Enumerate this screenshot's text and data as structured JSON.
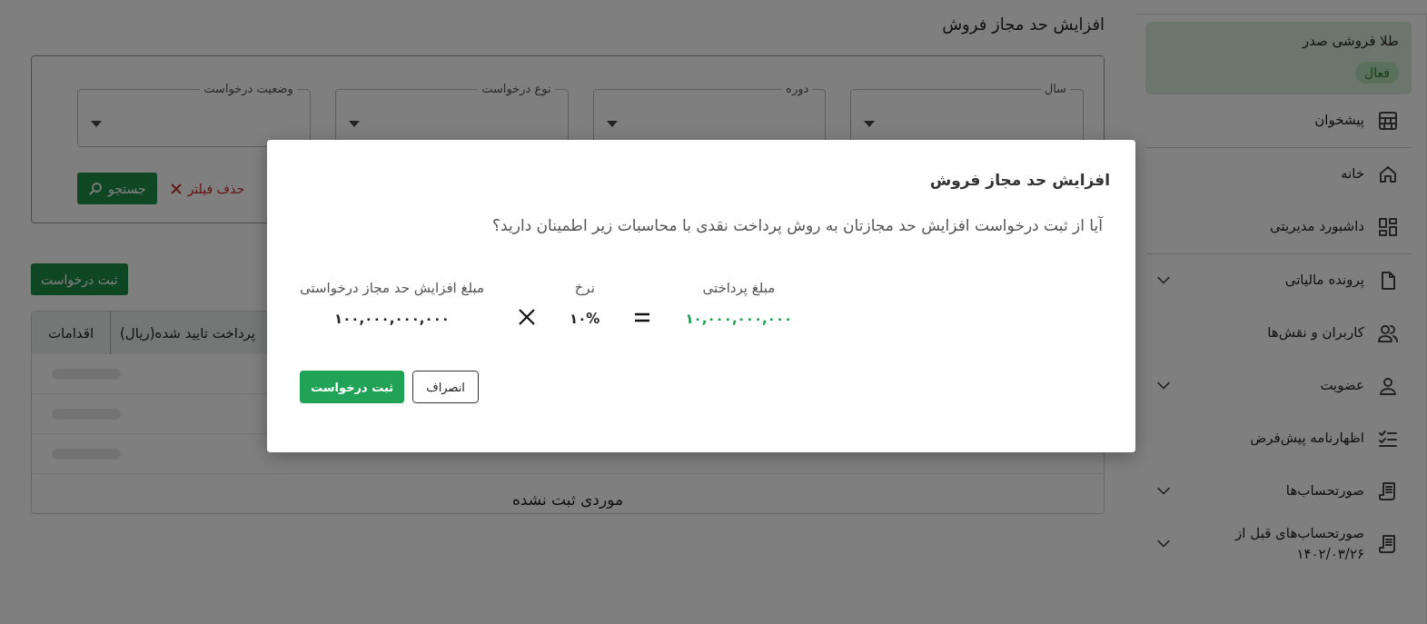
{
  "page": {
    "title": "افزایش حد مجاز فروش"
  },
  "filters": [
    {
      "label": "سال"
    },
    {
      "label": "دوره"
    },
    {
      "label": "نوع درخواست"
    },
    {
      "label": "وضعیت درخواست"
    }
  ],
  "filter_actions": {
    "clear": "حذف فیلتر",
    "search": "جستجو"
  },
  "register_button": "ثبت درخواست",
  "table": {
    "columns": [
      "پرداخت تایید شده(ریال)",
      "اقدامات"
    ],
    "rows": [
      {
        "loading": true
      },
      {
        "loading": true
      },
      {
        "loading": true
      }
    ],
    "empty_message": "موردی ثبت نشده"
  },
  "sidebar": {
    "org": {
      "name": "طلا فروشی صدر",
      "status": "فعال"
    },
    "groups": [
      [
        {
          "label": "پیشخوان",
          "kind": "counter",
          "expandable": false
        }
      ],
      [
        {
          "label": "خانه",
          "kind": "home",
          "expandable": false
        },
        {
          "label": "داشبورد مدیریتی",
          "kind": "dashboard",
          "expandable": false
        }
      ],
      [
        {
          "label": "پرونده مالیاتی",
          "kind": "file",
          "expandable": true
        },
        {
          "label": "کاربران و نقش‌ها",
          "kind": "users",
          "expandable": false
        },
        {
          "label": "عضویت",
          "kind": "user",
          "expandable": true
        },
        {
          "label": "اظهارنامه پیش‌فرض",
          "kind": "checklist",
          "expandable": false
        },
        {
          "label": "صورتحساب‌ها",
          "kind": "receipt",
          "expandable": true
        },
        {
          "label": "صورتحساب‌های قبل از ۱۴۰۲/۰۳/۲۶",
          "kind": "receipt",
          "expandable": true
        }
      ]
    ]
  },
  "modal": {
    "title": "افزایش حد مجاز فروش",
    "message": "آیا از ثبت درخواست افزایش حد مجازتان به روش پرداخت نقدی با محاسبات زیر اطمینان دارید؟",
    "calculation": [
      {
        "kind": "value",
        "label": "مبلغ پرداختی",
        "value": "۱۰,۰۰۰,۰۰۰,۰۰۰",
        "highlight": true
      },
      {
        "kind": "equals"
      },
      {
        "kind": "value",
        "label": "نرخ",
        "value": "۱۰%",
        "highlight": false
      },
      {
        "kind": "times"
      },
      {
        "kind": "value",
        "label": "مبلغ افزایش حد مجاز درخواستی",
        "value": "۱۰۰,۰۰۰,۰۰۰,۰۰۰",
        "highlight": false
      }
    ],
    "buttons": [
      {
        "label": "انصراف",
        "kind": "outline"
      },
      {
        "label": "ثبت درخواست",
        "kind": "primary"
      }
    ]
  }
}
